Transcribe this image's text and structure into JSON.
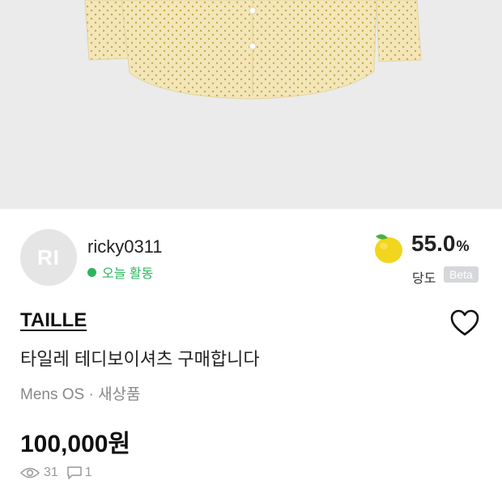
{
  "seller": {
    "avatar_initials": "RI",
    "username": "ricky0311",
    "activity": "오늘 활동",
    "activity_color": "#2bb55e"
  },
  "sweetness": {
    "icon": "apple-icon",
    "value": "55.0",
    "unit": "%",
    "label": "당도",
    "badge": "Beta"
  },
  "product": {
    "brand": "TAILLE",
    "title": "타일레 테디보이셔츠 구매합니다",
    "meta": "Mens OS · 새상품",
    "price": "100,000원"
  },
  "stats": {
    "views": "31",
    "comments": "1"
  },
  "colors": {
    "hero_bg": "#ebebeb",
    "shirt": "#f3e6b8",
    "accent_green": "#2bb55e"
  }
}
